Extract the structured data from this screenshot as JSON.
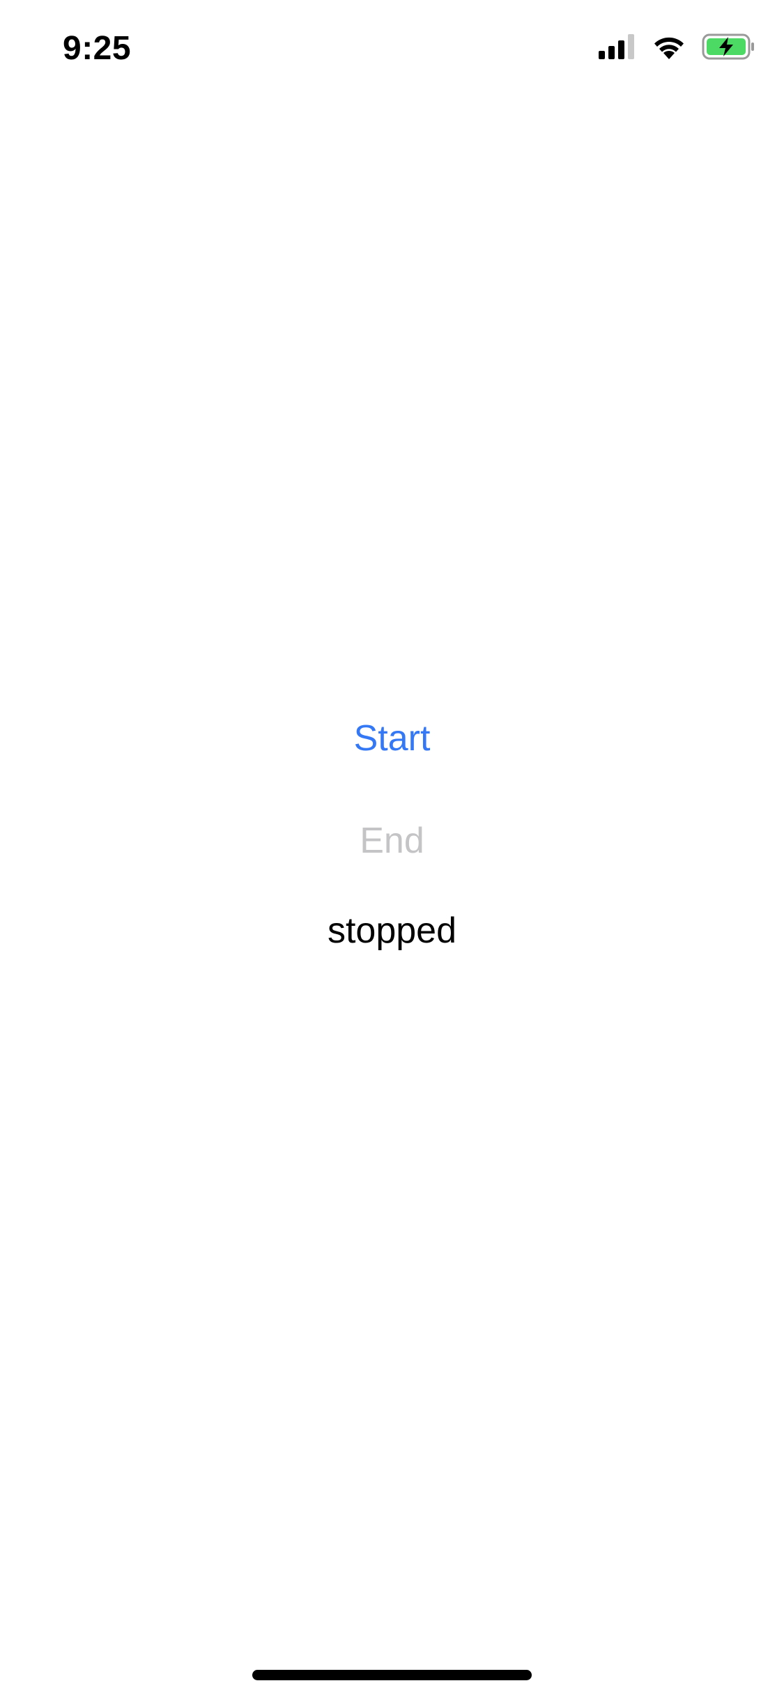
{
  "status_bar": {
    "time": "9:25",
    "signal_icon": "cellular-signal-icon",
    "wifi_icon": "wifi-icon",
    "battery_icon": "battery-charging-icon",
    "battery_color": "#4cd964"
  },
  "controls": {
    "start_label": "Start",
    "end_label": "End",
    "start_color": "#3478f6",
    "end_color": "#c4c4c6"
  },
  "state": {
    "label": "stopped"
  }
}
